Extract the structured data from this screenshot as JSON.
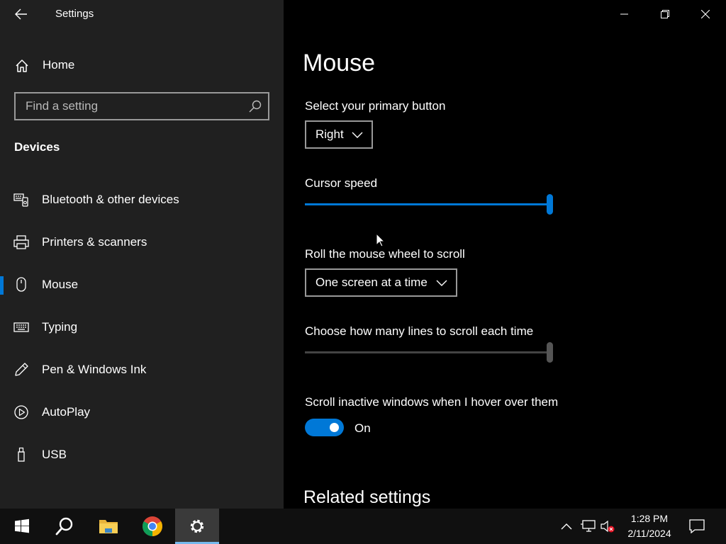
{
  "window": {
    "title": "Settings"
  },
  "sidebar": {
    "home_label": "Home",
    "search_placeholder": "Find a setting",
    "section_heading": "Devices",
    "items": [
      {
        "label": "Bluetooth & other devices",
        "icon": "bluetooth-devices-icon",
        "selected": false
      },
      {
        "label": "Printers & scanners",
        "icon": "printer-icon",
        "selected": false
      },
      {
        "label": "Mouse",
        "icon": "mouse-icon",
        "selected": true
      },
      {
        "label": "Typing",
        "icon": "keyboard-icon",
        "selected": false
      },
      {
        "label": "Pen & Windows Ink",
        "icon": "pen-icon",
        "selected": false
      },
      {
        "label": "AutoPlay",
        "icon": "autoplay-icon",
        "selected": false
      },
      {
        "label": "USB",
        "icon": "usb-icon",
        "selected": false
      }
    ]
  },
  "main": {
    "page_title": "Mouse",
    "primary_button": {
      "label": "Select your primary button",
      "value": "Right"
    },
    "cursor_speed": {
      "label": "Cursor speed",
      "value_fraction": 1.0
    },
    "scroll_mode": {
      "label": "Roll the mouse wheel to scroll",
      "value": "One screen at a time"
    },
    "scroll_lines": {
      "label": "Choose how many lines to scroll each time",
      "value_fraction": 1.0,
      "disabled": true
    },
    "inactive_scroll": {
      "label": "Scroll inactive windows when I hover over them",
      "state": "On"
    },
    "related_heading": "Related settings"
  },
  "taskbar": {
    "time": "1:28 PM",
    "date": "2/11/2024"
  },
  "colors": {
    "accent": "#0078d7",
    "sidebar_bg": "#202020",
    "main_bg": "#000000"
  }
}
